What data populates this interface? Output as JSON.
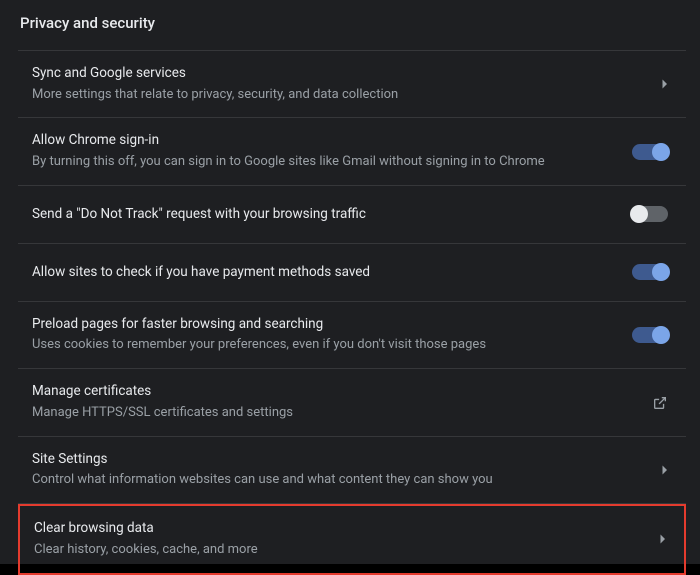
{
  "page": {
    "title": "Privacy and security"
  },
  "rows": [
    {
      "title": "Sync and Google services",
      "subtitle": "More settings that relate to privacy, security, and data collection",
      "action": "chevron"
    },
    {
      "title": "Allow Chrome sign-in",
      "subtitle": "By turning this off, you can sign in to Google sites like Gmail without signing in to Chrome",
      "action": "toggle",
      "toggle_on": true
    },
    {
      "title": "Send a \"Do Not Track\" request with your browsing traffic",
      "subtitle": "",
      "action": "toggle",
      "toggle_on": false
    },
    {
      "title": "Allow sites to check if you have payment methods saved",
      "subtitle": "",
      "action": "toggle",
      "toggle_on": true
    },
    {
      "title": "Preload pages for faster browsing and searching",
      "subtitle": "Uses cookies to remember your preferences, even if you don't visit those pages",
      "action": "toggle",
      "toggle_on": true
    },
    {
      "title": "Manage certificates",
      "subtitle": "Manage HTTPS/SSL certificates and settings",
      "action": "external"
    },
    {
      "title": "Site Settings",
      "subtitle": "Control what information websites can use and what content they can show you",
      "action": "chevron"
    },
    {
      "title": "Clear browsing data",
      "subtitle": "Clear history, cookies, cache, and more",
      "action": "chevron",
      "highlighted": true
    }
  ]
}
